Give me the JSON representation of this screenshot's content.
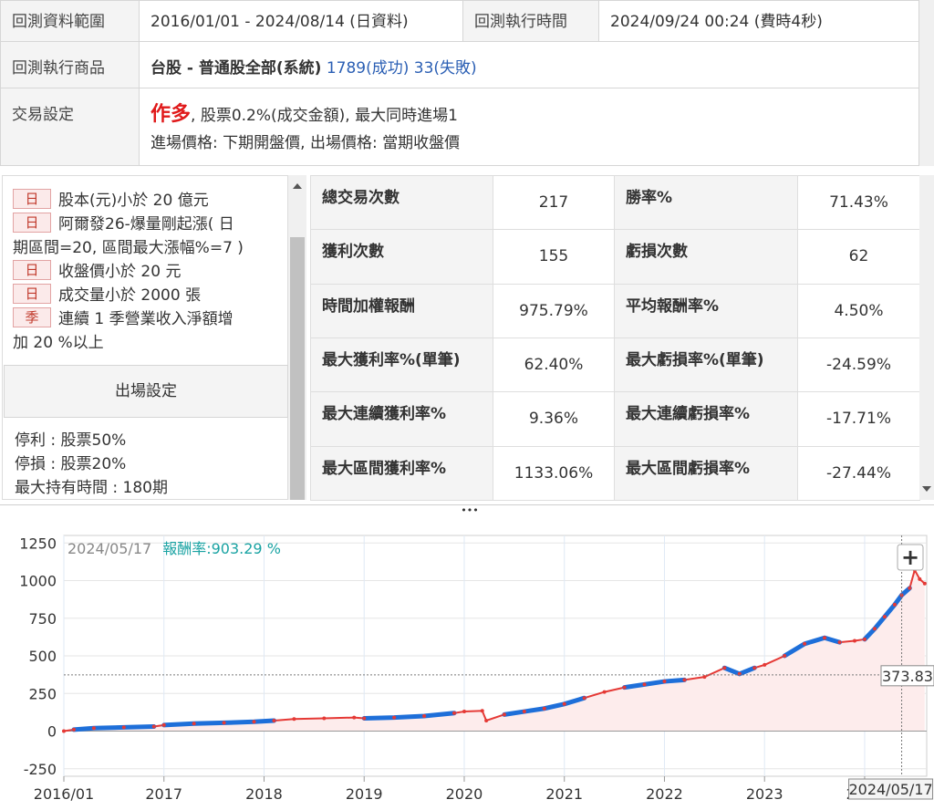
{
  "info": {
    "range_label": "回測資料範圍",
    "range_value": "2016/01/01 - 2024/08/14 (日資料)",
    "exec_time_label": "回測執行時間",
    "exec_time_value": "2024/09/24 00:24 (費時4秒)",
    "product_label": "回測執行商品",
    "product_value": "台股 - 普通股全部(系統)",
    "product_success": "1789(成功)",
    "product_fail": "33(失敗)",
    "trade_label": "交易設定",
    "trade_direction": "作多",
    "trade_detail": ", 股票0.2%(成交金額), 最大同時進場1",
    "trade_prices": "進場價格: 下期開盤價, 出場價格: 當期收盤價"
  },
  "conditions": [
    {
      "tag": "日",
      "text": "股本(元)小於 20 億元"
    },
    {
      "tag": "日",
      "text": "阿爾發26-爆量剛起漲( 日"
    },
    {
      "tag": "",
      "text": "期區間=20, 區間最大漲幅%=7 )"
    },
    {
      "tag": "日",
      "text": "收盤價小於 20 元"
    },
    {
      "tag": "日",
      "text": "成交量小於 2000 張"
    },
    {
      "tag": "季",
      "text": "連續 1 季營業收入淨額增"
    },
    {
      "tag": "",
      "text": "加 20 %以上"
    }
  ],
  "exit": {
    "title": "出場設定",
    "lines": [
      "停利 : 股票50%",
      "停損 : 股票20%",
      "最大持有時間 : 180期"
    ]
  },
  "stats": [
    {
      "l1": "總交易次數",
      "v1": "217",
      "l2": "勝率%",
      "v2": "71.43%",
      "r2": true
    },
    {
      "l1": "獲利次數",
      "v1": "155",
      "l2": "虧損次數",
      "v2": "62"
    },
    {
      "l1": "時間加權報酬",
      "v1": "975.79%",
      "r1": true,
      "l2": "平均報酬率%",
      "v2": "4.50%"
    },
    {
      "l1": "最大獲利率%(單筆)",
      "v1": "62.40%",
      "l2": "最大虧損率%(單筆)",
      "v2": "-24.59%"
    },
    {
      "l1": "最大連續獲利率%",
      "v1": "9.36%",
      "l2": "最大連續虧損率%",
      "v2": "-17.71%"
    },
    {
      "l1": "最大區間獲利率%",
      "v1": "1133.06%",
      "l2": "最大區間虧損率%",
      "v2": "-27.44%"
    }
  ],
  "splitter_glyph": "•••",
  "chart": {
    "tooltip_date": "2024/05/17",
    "tooltip_label": "報酬率:",
    "tooltip_value": "903.29 %",
    "zoom_button": "+",
    "crosshair_value": "373.83",
    "crosshair_date": "2024/05/17"
  },
  "chart_data": {
    "type": "line",
    "y_ticks": [
      1250,
      1000,
      750,
      500,
      250,
      0,
      -250
    ],
    "ylim": [
      -300,
      1300
    ],
    "x_ticks": [
      "2016/01",
      "2017",
      "2018",
      "2019",
      "2020",
      "2021",
      "2022",
      "2023",
      "2024"
    ],
    "x_tick_years": [
      2016.0,
      2017.0,
      2018.0,
      2019.0,
      2020.0,
      2021.0,
      2022.0,
      2023.0,
      2024.0
    ],
    "xlim": [
      2016.0,
      2024.62
    ],
    "series": [
      {
        "x": [
          2016.0,
          2016.1,
          2016.3,
          2016.6,
          2016.9,
          2017.0,
          2017.3,
          2017.6,
          2017.9,
          2018.1,
          2018.3,
          2018.6,
          2018.9,
          2019.0,
          2019.3,
          2019.6,
          2019.9,
          2020.0,
          2020.18,
          2020.22,
          2020.4,
          2020.6,
          2020.8,
          2021.0,
          2021.2,
          2021.4,
          2021.6,
          2021.8,
          2022.0,
          2022.2,
          2022.4,
          2022.6,
          2022.75,
          2022.9,
          2023.0,
          2023.2,
          2023.4,
          2023.6,
          2023.75,
          2023.9,
          2024.0,
          2024.1,
          2024.2,
          2024.3,
          2024.37,
          2024.45,
          2024.5,
          2024.55,
          2024.6
        ],
        "y": [
          0,
          10,
          20,
          25,
          30,
          40,
          50,
          55,
          62,
          70,
          80,
          85,
          90,
          85,
          90,
          100,
          120,
          130,
          135,
          70,
          110,
          130,
          150,
          180,
          220,
          260,
          290,
          310,
          330,
          340,
          360,
          420,
          380,
          420,
          440,
          500,
          580,
          620,
          590,
          600,
          610,
          680,
          760,
          840,
          903,
          950,
          1070,
          1010,
          980
        ]
      }
    ]
  },
  "colors": {
    "line": "#e53935",
    "highlight": "#1e6fd9",
    "area": "#fdecec",
    "accent_red": "#e0191a",
    "link_blue": "#2b5fb4",
    "tooltip_teal": "#1aa3a3"
  }
}
